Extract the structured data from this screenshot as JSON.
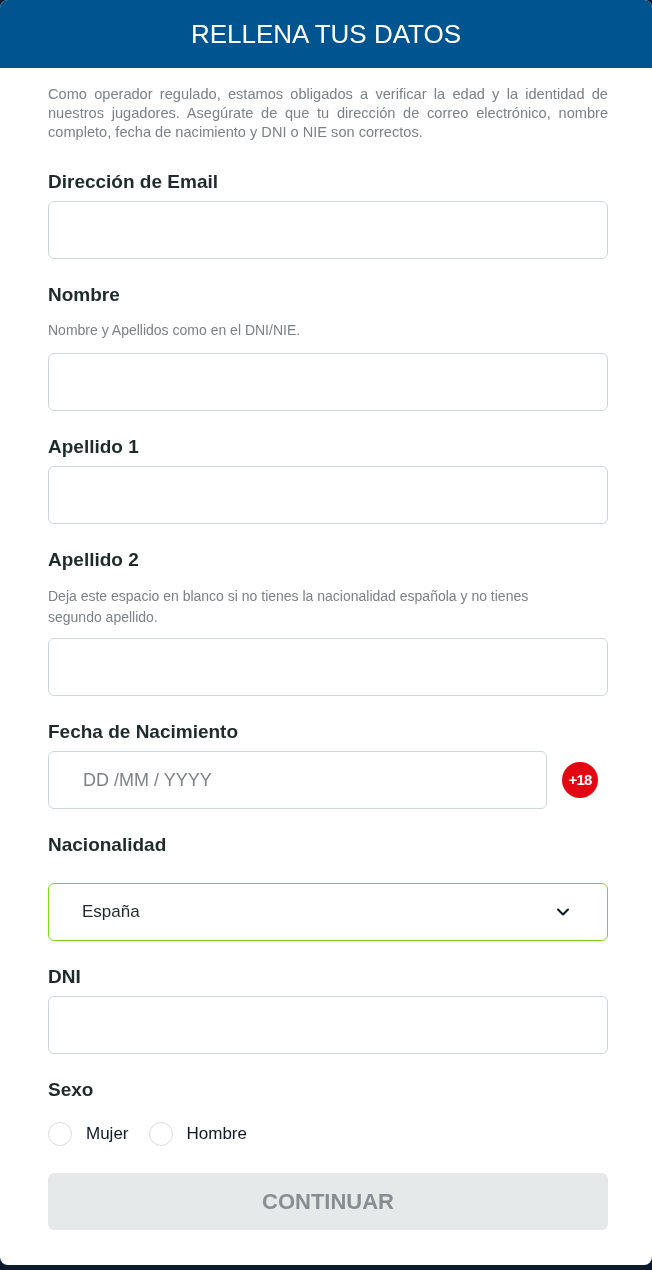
{
  "header": {
    "title": "RELLENA TUS DATOS"
  },
  "intro": "Como operador regulado, estamos obligados a verificar la edad y la identidad de nuestros jugadores. Asegúrate de que tu dirección de correo electrónico, nombre completo, fecha de nacimiento y DNI o NIE son correctos.",
  "fields": [
    {
      "kind": "text",
      "label": "Dirección de Email"
    },
    {
      "kind": "text",
      "label": "Nombre",
      "hint": "Nombre y Apellidos como en el DNI/NIE."
    },
    {
      "kind": "text",
      "label": "Apellido 1"
    },
    {
      "kind": "text",
      "label": "Apellido 2",
      "hint": "Deja este espacio en blanco si no tienes la nacionalidad española y no tienes segundo apellido."
    },
    {
      "kind": "date",
      "label": "Fecha de Nacimiento",
      "placeholder": "DD /MM / YYYY",
      "badge": "+18"
    },
    {
      "kind": "select",
      "label": "Nacionalidad",
      "value": "España",
      "focused": true
    },
    {
      "kind": "text",
      "label": "DNI"
    },
    {
      "kind": "radio",
      "label": "Sexo",
      "options": [
        {
          "label": "Mujer",
          "selected": false
        },
        {
          "label": "Hombre",
          "selected": false
        }
      ]
    }
  ],
  "submit": {
    "label": "CONTINUAR",
    "disabled": true
  }
}
